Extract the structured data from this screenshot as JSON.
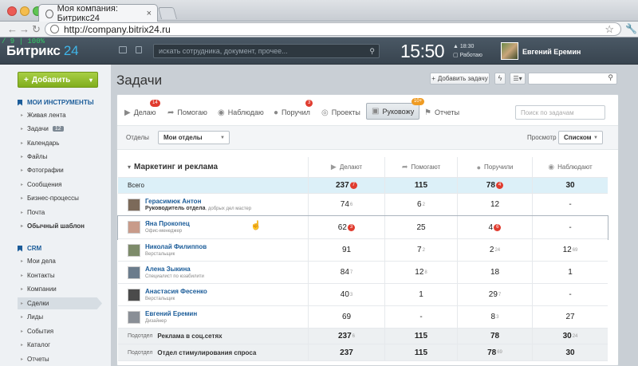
{
  "browser": {
    "tab_title": "Моя компания: Битрикс24",
    "close_glyph": "×",
    "url": "http://company.bitrix24.ru"
  },
  "portal": {
    "logo_main": "Битрикс",
    "logo_num": "24",
    "debug": "/ 9 | 100%",
    "search_placeholder": "искать сотрудника, документ, прочее...",
    "clock": "15:50",
    "alarm_time": "18:30",
    "status": "Работаю",
    "user_name": "Евгений Еремин"
  },
  "sidebar": {
    "add_button": "Добавить",
    "sections": [
      {
        "title": "МОИ ИНСТРУМЕНТЫ"
      },
      {
        "title": "CRM"
      }
    ],
    "tools": [
      {
        "label": "Живая лента"
      },
      {
        "label": "Задачи",
        "badge": "12"
      },
      {
        "label": "Календарь"
      },
      {
        "label": "Файлы"
      },
      {
        "label": "Фотографии"
      },
      {
        "label": "Сообщения"
      },
      {
        "label": "Бизнес-процессы"
      },
      {
        "label": "Почта"
      },
      {
        "label": "Обычный шаблон"
      }
    ],
    "crm": [
      {
        "label": "Мои дела"
      },
      {
        "label": "Контакты"
      },
      {
        "label": "Компании"
      },
      {
        "label": "Сделки"
      },
      {
        "label": "Лиды"
      },
      {
        "label": "События"
      },
      {
        "label": "Каталог"
      },
      {
        "label": "Отчеты"
      }
    ]
  },
  "main": {
    "title": "Задачи",
    "add_task": "Добавить задачу",
    "tabs": [
      {
        "label": "Делаю",
        "count": "14"
      },
      {
        "label": "Помогаю"
      },
      {
        "label": "Наблюдаю"
      },
      {
        "label": "Поручил",
        "count": "3"
      },
      {
        "label": "Проекты"
      },
      {
        "label": "Руковожу",
        "count": "10+"
      },
      {
        "label": "Отчеты"
      }
    ],
    "tab_search_placeholder": "Поиск по задачам",
    "filter_label": "Отделы",
    "filter_value": "Мои отделы",
    "view_label": "Просмотр",
    "view_value": "Списком"
  },
  "table": {
    "group_title": "Маркетинг и реклама",
    "columns": [
      "Делают",
      "Помогают",
      "Поручили",
      "Наблюдают"
    ],
    "total": {
      "label": "Всего",
      "v": [
        "237",
        "115",
        "78",
        "30"
      ],
      "badges": [
        "7",
        "",
        "4",
        ""
      ]
    },
    "rows": [
      {
        "name": "Герасимюк Антон",
        "pos_bold": "Руководитель отдела",
        "pos": ", добрых дел мастер",
        "v": [
          "74",
          "6",
          "12",
          "-"
        ],
        "sup": [
          "6",
          "2",
          "",
          ""
        ]
      },
      {
        "name": "Яна Прокопец",
        "pos_bold": "",
        "pos": "Офис-менеджер",
        "v": [
          "62",
          "25",
          "4",
          "-"
        ],
        "red": [
          "3",
          "",
          "6",
          ""
        ]
      },
      {
        "name": "Николай Филиппов",
        "pos_bold": "",
        "pos": "Верстальщик",
        "v": [
          "91",
          "7",
          "2",
          "12"
        ],
        "sup": [
          "",
          "2",
          "24",
          "69"
        ]
      },
      {
        "name": "Алена Зыкина",
        "pos_bold": "",
        "pos": "Специалист по юзабилити",
        "v": [
          "84",
          "12",
          "18",
          "1"
        ],
        "sup": [
          "7",
          "8",
          "",
          ""
        ]
      },
      {
        "name": "Анастасия Фесенко",
        "pos_bold": "",
        "pos": "Верстальщик",
        "v": [
          "40",
          "1",
          "29",
          "-"
        ],
        "sup": [
          "3",
          "",
          "7",
          ""
        ]
      },
      {
        "name": "Евгений Еремин",
        "pos_bold": "",
        "pos": "Дизайнер",
        "v": [
          "69",
          "-",
          "8",
          "27"
        ],
        "sup": [
          "",
          "",
          "3",
          ""
        ]
      }
    ],
    "subdepts": [
      {
        "label": "Подотдел",
        "name": "Реклама в соц.сетях",
        "v": [
          "237",
          "115",
          "78",
          "30"
        ],
        "sup": [
          "6",
          "",
          "",
          "24"
        ]
      },
      {
        "label": "Подотдел",
        "name": "Отдел стимулирования спроса",
        "v": [
          "237",
          "115",
          "78",
          "30"
        ],
        "sup": [
          "",
          "",
          "69",
          ""
        ]
      }
    ]
  },
  "colors": {
    "accent": "#1b5c99",
    "add_button": "#8dbb2a",
    "badge": "#e03c2f",
    "total_row": "#dcf0f8"
  }
}
